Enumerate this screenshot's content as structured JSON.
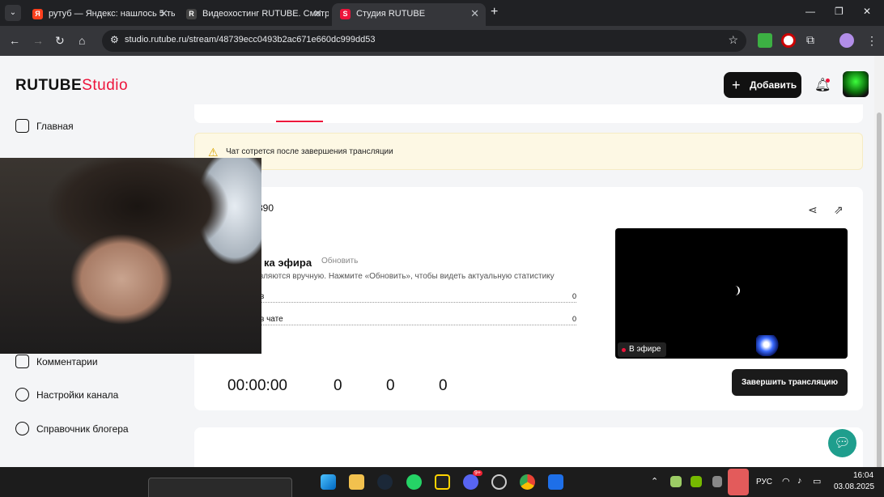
{
  "browser": {
    "tabs": [
      {
        "label": "рутуб — Яндекс: нашлось 5 тыс",
        "favicon": "Я"
      },
      {
        "label": "Видеохостинг RUTUBE. Смотри",
        "favicon": "R"
      },
      {
        "label": "Студия RUTUBE",
        "favicon": "S"
      }
    ],
    "url": "studio.rutube.ru/stream/48739ecc0493b2ac671e660dc999dd53"
  },
  "header": {
    "logo_main": "RUTUBE",
    "logo_studio": "Studio",
    "add_label": "Добавить",
    "accent": "#ed143b"
  },
  "sidebar": {
    "items": [
      {
        "label": "Главная",
        "icon": "home-icon"
      },
      {
        "label": "Комментарии",
        "icon": "comments-icon"
      },
      {
        "label": "Настройки канала",
        "icon": "settings-icon"
      },
      {
        "label": "Справочник блогера",
        "icon": "info-icon"
      }
    ]
  },
  "notice": {
    "text": "Чат сотрется после завершения трансляции"
  },
  "stream": {
    "id_fragment": "890",
    "stats_title": "ка эфира",
    "refresh_label": "Обновить",
    "stats_note": "вляются вручную. Нажмите «Обновить», чтобы видеть актуальную статистику",
    "rows": [
      {
        "label": "в",
        "value": "0"
      },
      {
        "label": "в чате",
        "value": "0"
      }
    ],
    "live_label": "В эфире",
    "timer": "00:00:00",
    "metrics": [
      "0",
      "0",
      "0"
    ],
    "end_label": "Завершить трансляцию"
  },
  "taskbar": {
    "lang": "РУС",
    "time": "16:04",
    "date": "03.08.2025",
    "discord_badge": "9+"
  }
}
